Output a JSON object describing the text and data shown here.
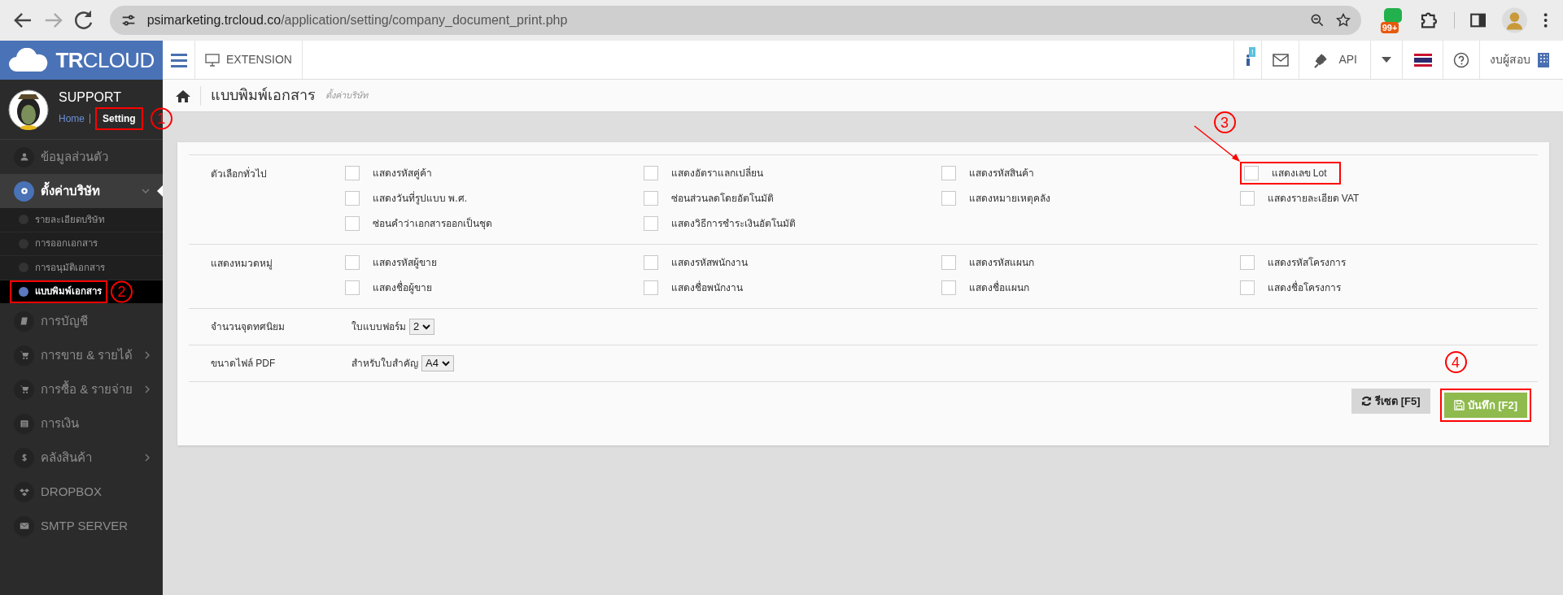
{
  "browser": {
    "url_host": "psimarketing.trcloud.co",
    "url_path": "/application/setting/company_document_print.php",
    "extension_badge": "99+"
  },
  "logo": {
    "bold": "TR",
    "rest": "CLOUD"
  },
  "header": {
    "extension": "EXTENSION",
    "info_badge": "!",
    "api": "API",
    "company": "งบผู้สอบ"
  },
  "profile": {
    "name": "SUPPORT",
    "links": [
      {
        "label": "Home",
        "current": false
      },
      {
        "label": "Setting",
        "current": true,
        "callout": {
          "number": "1"
        }
      }
    ]
  },
  "sidebar": {
    "items": [
      {
        "label": "ข้อมูลส่วนตัว",
        "selected": false
      },
      {
        "label": "ตั้งค่าบริษัท",
        "selected": true,
        "expanded": true,
        "children": [
          {
            "label": "รายละเอียดบริษัท",
            "selected": false
          },
          {
            "label": "การออกเอกสาร",
            "selected": false
          },
          {
            "label": "การอนุมัติเอกสาร",
            "selected": false
          },
          {
            "label": "แบบพิมพ์เอกสาร",
            "selected": true,
            "callout": {
              "number": "2"
            }
          }
        ]
      },
      {
        "label": "การบัญชี",
        "selected": false
      },
      {
        "label": "การขาย & รายได้",
        "selected": false,
        "expanded": false
      },
      {
        "label": "การซื้อ & รายจ่าย",
        "selected": false,
        "expanded": false
      },
      {
        "label": "การเงิน",
        "selected": false
      },
      {
        "label": "คลังสินค้า",
        "selected": false,
        "expanded": false
      },
      {
        "label": "DROPBOX",
        "selected": false
      },
      {
        "label": "SMTP SERVER",
        "selected": false
      }
    ]
  },
  "page": {
    "title": "แบบพิมพ์เอกสาร",
    "subtitle": "ตั้งค่าบริษัท"
  },
  "sections": [
    {
      "kind": "checkboxes",
      "label": "ตัวเลือกทั่วไป",
      "options": [
        {
          "label": "แสดงรหัสคู่ค้า",
          "checked": false
        },
        {
          "label": "แสดงอัตราแลกเปลี่ยน",
          "checked": false
        },
        {
          "label": "แสดงรหัสสินค้า",
          "checked": false
        },
        {
          "label": "แสดงเลข Lot",
          "checked": false,
          "callout": {
            "number": "3",
            "arrow": true
          }
        },
        {
          "label": "แสดงวันที่รูปแบบ พ.ศ.",
          "checked": false
        },
        {
          "label": "ซ่อนส่วนลดโดยอัตโนมัติ",
          "checked": false
        },
        {
          "label": "แสดงหมายเหตุคลัง",
          "checked": false
        },
        {
          "label": "แสดงรายละเอียด VAT",
          "checked": false
        },
        {
          "label": "ซ่อนคำว่าเอกสารออกเป็นชุด",
          "checked": false
        },
        {
          "label": "แสดงวิธีการชำระเงินอัตโนมัติ",
          "checked": false
        }
      ]
    },
    {
      "kind": "checkboxes",
      "label": "แสดงหมวดหมู่",
      "options": [
        {
          "label": "แสดงรหัสผู้ขาย",
          "checked": false
        },
        {
          "label": "แสดงรหัสพนักงาน",
          "checked": false
        },
        {
          "label": "แสดงรหัสแผนก",
          "checked": false
        },
        {
          "label": "แสดงรหัสโครงการ",
          "checked": false
        },
        {
          "label": "แสดงชื่อผู้ขาย",
          "checked": false
        },
        {
          "label": "แสดงชื่อพนักงาน",
          "checked": false
        },
        {
          "label": "แสดงชื่อแผนก",
          "checked": false
        },
        {
          "label": "แสดงชื่อโครงการ",
          "checked": false
        }
      ]
    },
    {
      "kind": "select",
      "label": "จำนวนจุดทศนิยม",
      "prefix": "ใบแบบฟอร์ม",
      "value": "2"
    },
    {
      "kind": "select",
      "label": "ขนาดไฟล์ PDF",
      "prefix": "สำหรับใบสำคัญ",
      "value": "A4"
    }
  ],
  "buttons": [
    {
      "kind": "reset",
      "label": "รีเซต [F5]"
    },
    {
      "kind": "save",
      "label": "บันทึก [F2]",
      "callout": {
        "number": "4"
      }
    }
  ]
}
